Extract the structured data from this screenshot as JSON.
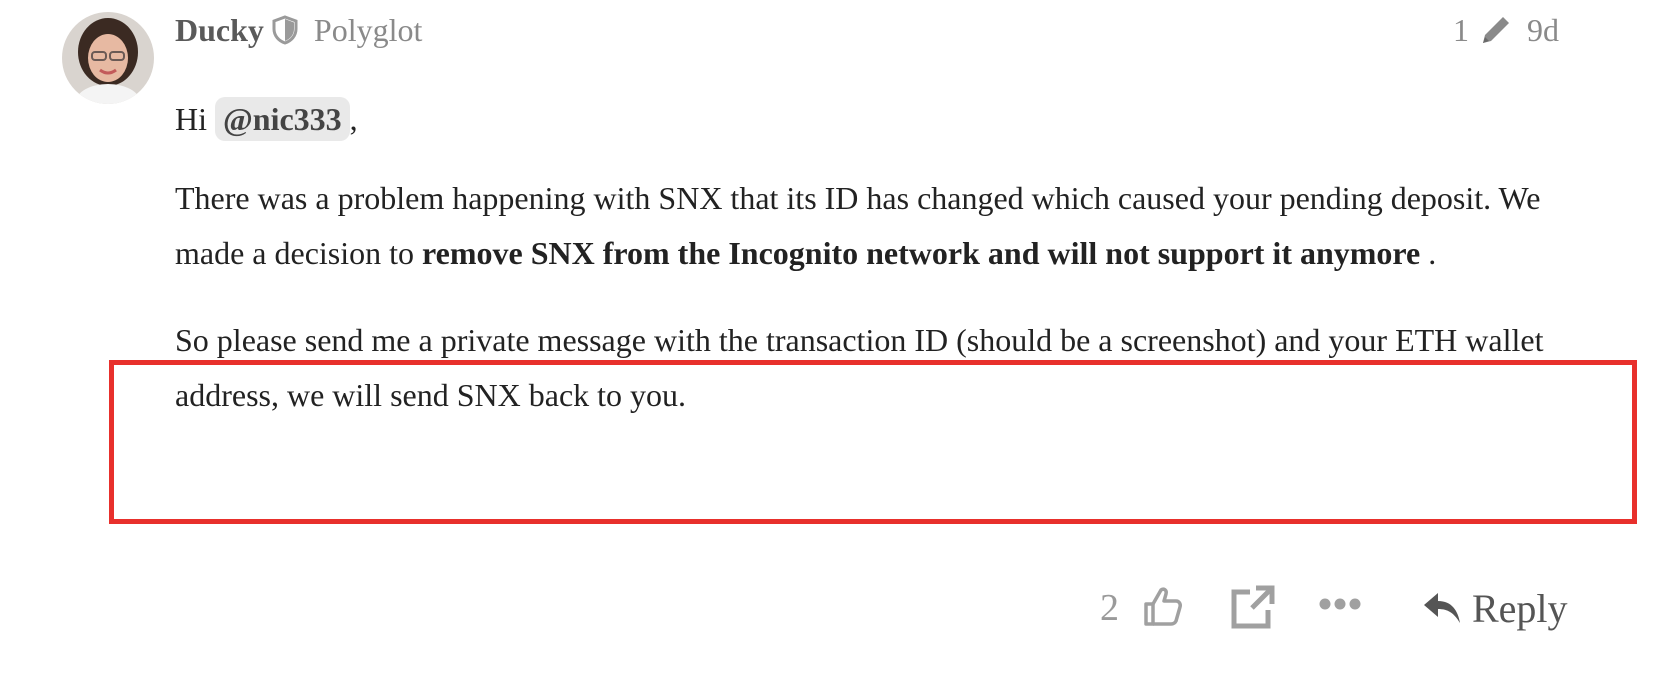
{
  "post": {
    "username": "Ducky",
    "user_title": "Polyglot",
    "edit_count": "1",
    "age": "9d",
    "greeting_prefix": "Hi",
    "mention": "@nic333",
    "greeting_suffix": ",",
    "p2_part1": "There was a problem happening with SNX that its ID has changed which caused your pending deposit. We made a decision to ",
    "p2_bold": "remove SNX from the Incognito network and will not support it anymore",
    "p2_part2": " .",
    "p3": "So please send me a private message with the transaction ID (should be a screenshot) and your ETH wallet address, we will send SNX back to you."
  },
  "actions": {
    "like_count": "2",
    "reply_label": "Reply"
  },
  "icons": {
    "shield": "shield-icon",
    "pencil": "pencil-icon",
    "like": "thumbs-up-icon",
    "share": "share-icon",
    "more": "more-icon",
    "reply": "reply-icon"
  },
  "colors": {
    "highlight_border": "#e8302c",
    "mention_bg": "#e9e9e9",
    "muted_text": "#8a8a8a"
  }
}
